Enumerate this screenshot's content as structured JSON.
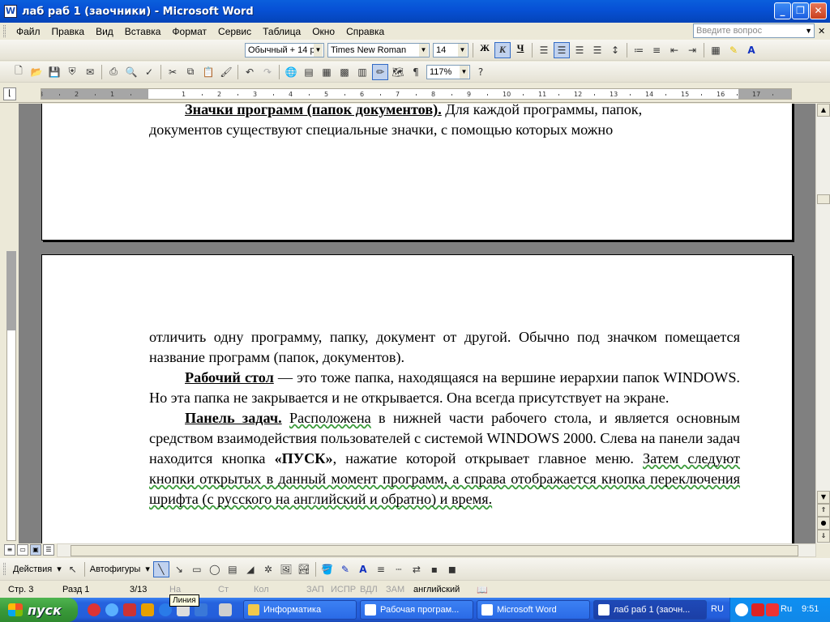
{
  "window": {
    "title": "лаб раб 1 (заочники) - Microsoft Word",
    "app_icon": "W"
  },
  "menu": [
    "Файл",
    "Правка",
    "Вид",
    "Вставка",
    "Формат",
    "Сервис",
    "Таблица",
    "Окно",
    "Справка"
  ],
  "help_box": {
    "placeholder": "Введите вопрос"
  },
  "formatting": {
    "style": "Обычный + 14 р",
    "font": "Times New Roman",
    "size": "14",
    "bold_label": "Ж",
    "italic_label": "К",
    "underline_label": "Ч",
    "italic_active": true,
    "align_center_active": true
  },
  "standard": {
    "zoom": "117%"
  },
  "ruler": {
    "ticks": [
      "3",
      "2",
      "1",
      "1",
      "2",
      "3",
      "4",
      "5",
      "6",
      "7",
      "8",
      "9",
      "10",
      "11",
      "12",
      "13",
      "14",
      "15",
      "16",
      "17"
    ]
  },
  "document": {
    "page1_lines": [
      {
        "bold_underline": "Значки программ (папок документов).",
        "rest": " Для каждой программы, папок,"
      },
      {
        "text": "документов существуют специальные значки, с помощью которых можно"
      }
    ],
    "page2": {
      "p1": "отличить одну программу, папку, документ от другой. Обычно под значком помещается название программ (папок, документов).",
      "p2_term": "Рабочий стол",
      "p2_rest": " — это тоже папка, находящаяся на вершине иерархии папок WINDOWS. Но эта папка не закрывается и не открывается. Она всегда присутствует на экране.",
      "p3_term": "Панель задач.",
      "p3_a": " ",
      "p3_wave1": "Расположена",
      "p3_b": " в нижней части рабочего стола, и является основным средством взаимодействия пользователей с системой WINDOWS 2000. Слева на панели задач находится кнопка ",
      "p3_bold": "«ПУСК»",
      "p3_c": ", нажатие которой открывает главное меню. ",
      "p3_wave2": "Затем следуют кнопки открытых в данный момент программ, а справа отображается кнопка переключения шрифта (с русского на английский и обратно) и время."
    }
  },
  "drawing_toolbar": {
    "actions": "Действия",
    "autoshapes": "Автофигуры",
    "tooltip": "Линия"
  },
  "status": {
    "page": "Стр. 3",
    "section": "Разд 1",
    "pages": "3/13",
    "at": "На",
    "line": "Ст",
    "col": "Кол",
    "rec": "ЗАП",
    "trk": "ИСПР",
    "ext": "ВДЛ",
    "ovr": "ЗАМ",
    "lang": "английский"
  },
  "taskbar": {
    "start": "пуск",
    "tasks": [
      "Информатика",
      "Рабочая програм...",
      "Microsoft Word",
      "лаб раб 1 (заочн..."
    ],
    "active_task": 3,
    "lang": "RU",
    "tray_lang": "Ru",
    "clock": "9:51"
  }
}
